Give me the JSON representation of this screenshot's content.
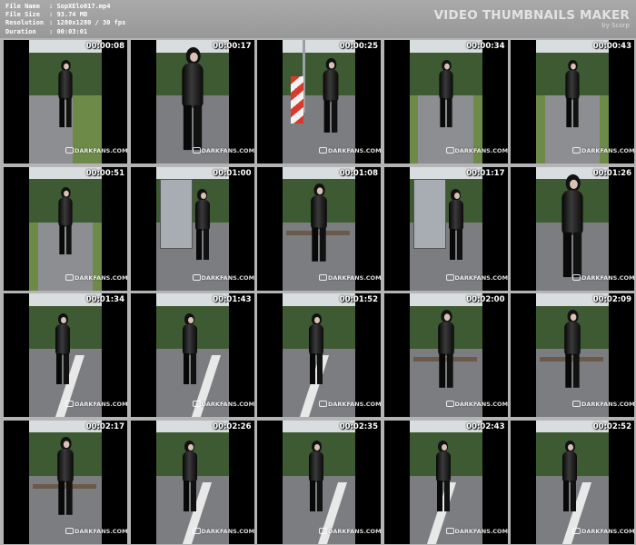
{
  "info": {
    "file_name_label": "File Name",
    "file_name": "SopXElo017.mp4",
    "file_size_label": "File Size",
    "file_size": "93.74 MB",
    "resolution_label": "Resolution",
    "resolution": "1280x1280 / 30 fps",
    "duration_label": "Duration",
    "duration": "00:03:01"
  },
  "brand": {
    "title": "VIDEO THUMBNAILS MAKER",
    "subtitle": "by Scorp"
  },
  "watermark": "DARKFANS.COM",
  "thumbnails": [
    {
      "time": "00:00:08",
      "scene": "park-walk"
    },
    {
      "time": "00:00:17",
      "scene": "closeup"
    },
    {
      "time": "00:00:25",
      "scene": "sign"
    },
    {
      "time": "00:00:34",
      "scene": "road"
    },
    {
      "time": "00:00:43",
      "scene": "road"
    },
    {
      "time": "00:00:51",
      "scene": "road"
    },
    {
      "time": "00:01:00",
      "scene": "shelter"
    },
    {
      "time": "00:01:08",
      "scene": "bench"
    },
    {
      "time": "00:01:17",
      "scene": "shelter"
    },
    {
      "time": "00:01:26",
      "scene": "closeup"
    },
    {
      "time": "00:01:34",
      "scene": "platform"
    },
    {
      "time": "00:01:43",
      "scene": "platform"
    },
    {
      "time": "00:01:52",
      "scene": "platform"
    },
    {
      "time": "00:02:00",
      "scene": "bench"
    },
    {
      "time": "00:02:09",
      "scene": "bench"
    },
    {
      "time": "00:02:17",
      "scene": "bench"
    },
    {
      "time": "00:02:26",
      "scene": "platform"
    },
    {
      "time": "00:02:35",
      "scene": "platform"
    },
    {
      "time": "00:02:43",
      "scene": "platform"
    },
    {
      "time": "00:02:52",
      "scene": "platform"
    }
  ]
}
